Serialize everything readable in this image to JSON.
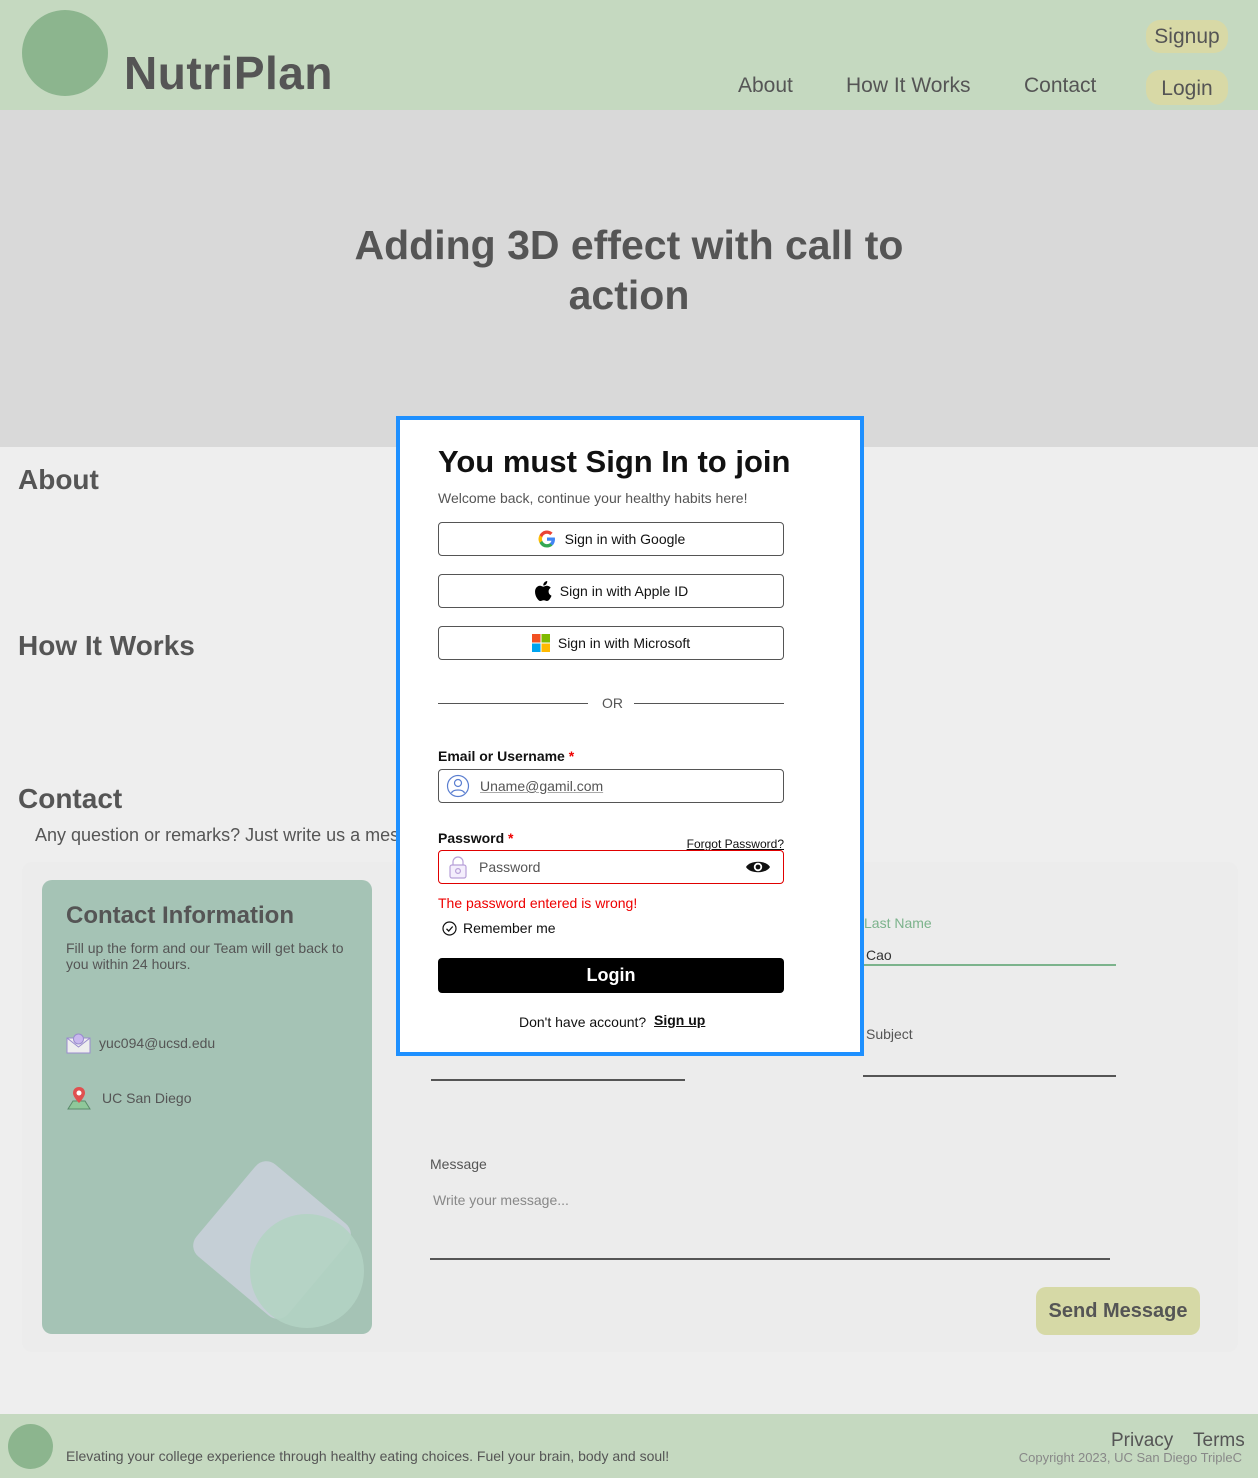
{
  "brand": {
    "name": "NutriPlan"
  },
  "nav": {
    "about": "About",
    "how": "How It Works",
    "contact": "Contact",
    "signup": "Signup",
    "login": "Login"
  },
  "hero": {
    "title": "Adding 3D effect with call to action"
  },
  "sections": {
    "about": "About",
    "how": "How It Works",
    "contact": "Contact",
    "contact_sub": "Any question or remarks? Just write us a mes"
  },
  "contact_info": {
    "title": "Contact Information",
    "desc": "Fill up the form and our Team will get back to you within 24 hours.",
    "email": "yuc094@ucsd.edu",
    "location": "UC San Diego"
  },
  "form": {
    "last_name_label": "Last Name",
    "last_name_value": "Cao",
    "subject_label": "Subject",
    "message_label": "Message",
    "message_placeholder": "Write your message...",
    "send": "Send Message"
  },
  "footer": {
    "tagline": "Elevating your college experience through healthy eating choices. Fuel your brain, body and soul!",
    "privacy": "Privacy",
    "terms": "Terms",
    "copyright": "Copyright 2023, UC San Diego TripleC"
  },
  "modal": {
    "title": "You must Sign In to join",
    "subtitle": "Welcome back, continue your healthy habits here!",
    "google": "Sign in with Google",
    "apple": "Sign in with Apple ID",
    "microsoft": "Sign in with Microsoft",
    "or": "OR",
    "email_label": "Email or Username",
    "required_mark": "*",
    "email_value": "Uname@gamil.com",
    "password_label": "Password",
    "forgot": "Forgot Password?",
    "password_placeholder": "Password",
    "error": "The password entered is wrong!",
    "remember": "Remember me",
    "login": "Login",
    "no_account": "Don't have account?",
    "signup": "Sign up"
  },
  "colors": {
    "header": "#c5d9c0",
    "accent_pill": "#d8d9a6",
    "modal_border": "#1e90ff",
    "error": "#e00000"
  }
}
